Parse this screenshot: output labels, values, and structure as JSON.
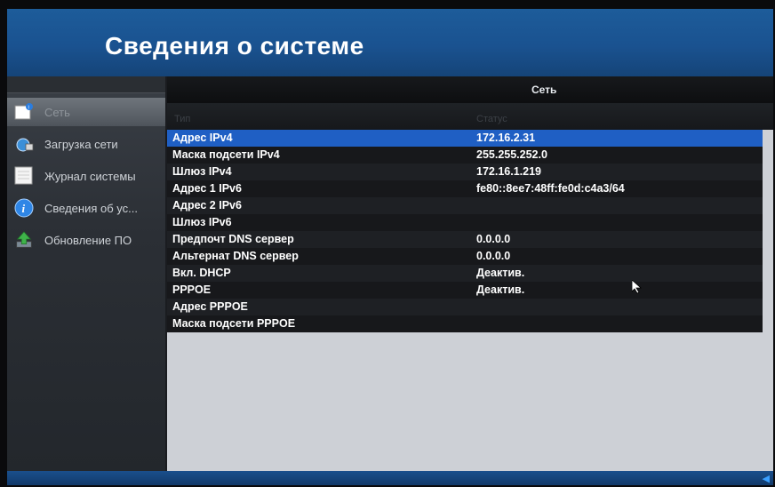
{
  "header": {
    "title": "Сведения о системе"
  },
  "sidebar": {
    "items": [
      {
        "label": "Сеть",
        "icon": "device-info-icon",
        "active": true
      },
      {
        "label": "Загрузка сети",
        "icon": "network-load-icon",
        "active": false
      },
      {
        "label": "Журнал системы",
        "icon": "log-icon",
        "active": false
      },
      {
        "label": "Сведения об ус...",
        "icon": "info-icon",
        "active": false
      },
      {
        "label": "Обновление ПО",
        "icon": "upgrade-icon",
        "active": false
      }
    ]
  },
  "main": {
    "tab_label": "Сеть",
    "columns": [
      "Тип",
      "Статус"
    ],
    "rows": [
      {
        "key": "Адрес IPv4",
        "value": "172.16.2.31"
      },
      {
        "key": "Маска подсети IPv4",
        "value": "255.255.252.0"
      },
      {
        "key": "Шлюз IPv4",
        "value": "172.16.1.219"
      },
      {
        "key": "Адрес 1 IPv6",
        "value": "fe80::8ee7:48ff:fe0d:c4a3/64"
      },
      {
        "key": "Адрес 2 IPv6",
        "value": ""
      },
      {
        "key": "Шлюз IPv6",
        "value": ""
      },
      {
        "key": "Предпочт DNS сервер",
        "value": "0.0.0.0"
      },
      {
        "key": "Альтернат DNS сервер",
        "value": "0.0.0.0"
      },
      {
        "key": "Вкл. DHCP",
        "value": "Деактив."
      },
      {
        "key": "PPPOE",
        "value": "Деактив."
      },
      {
        "key": "Адрес PPPOE",
        "value": ""
      },
      {
        "key": "Маска подсети PPPOE",
        "value": ""
      }
    ]
  },
  "colors": {
    "header": "#1a5290",
    "selected_row": "#1f5fc4",
    "panel": "#cdd0d6"
  }
}
